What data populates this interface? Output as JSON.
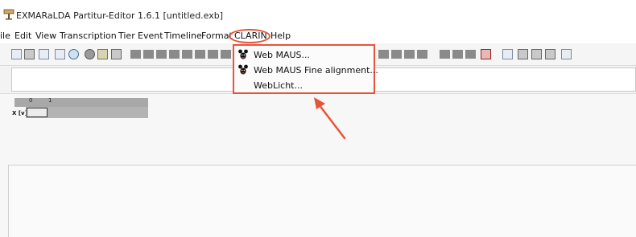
{
  "window": {
    "title": "EXMARaLDA Partitur-Editor 1.6.1 [untitled.exb]",
    "app_icon": "exmaralda-app-icon"
  },
  "menubar": {
    "items": [
      "ile",
      "Edit",
      "View",
      "Transcription",
      "Tier",
      "Event",
      "Timeline",
      "Format",
      "CLARIN",
      "Help"
    ]
  },
  "clarin_menu": {
    "items": [
      {
        "label": "Web MAUS...",
        "icon": "maus-icon"
      },
      {
        "label": "Web MAUS Fine alignment...",
        "icon": "maus-icon"
      },
      {
        "label": "WebLicht...",
        "icon": ""
      }
    ]
  },
  "partitur": {
    "ruler_numbers": [
      "0",
      "1"
    ],
    "tier_label": "X [v]"
  },
  "colors": {
    "highlight": "#e8543a"
  }
}
